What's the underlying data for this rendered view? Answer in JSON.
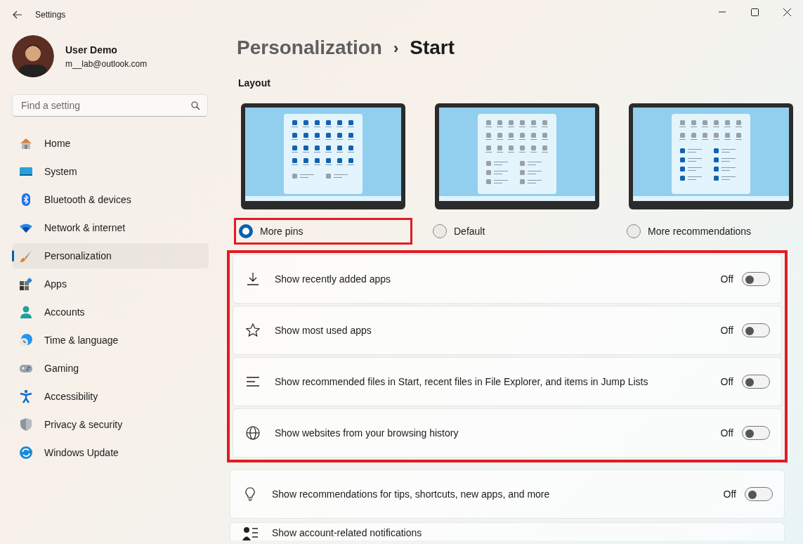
{
  "window": {
    "title": "Settings"
  },
  "user": {
    "name": "User Demo",
    "email": "m__lab@outlook.com"
  },
  "search": {
    "placeholder": "Find a setting"
  },
  "sidebar": {
    "items": [
      {
        "label": "Home",
        "selected": false
      },
      {
        "label": "System",
        "selected": false
      },
      {
        "label": "Bluetooth & devices",
        "selected": false
      },
      {
        "label": "Network & internet",
        "selected": false
      },
      {
        "label": "Personalization",
        "selected": true
      },
      {
        "label": "Apps",
        "selected": false
      },
      {
        "label": "Accounts",
        "selected": false
      },
      {
        "label": "Time & language",
        "selected": false
      },
      {
        "label": "Gaming",
        "selected": false
      },
      {
        "label": "Accessibility",
        "selected": false
      },
      {
        "label": "Privacy & security",
        "selected": false
      },
      {
        "label": "Windows Update",
        "selected": false
      }
    ]
  },
  "breadcrumb": {
    "parent": "Personalization",
    "separator": "›",
    "current": "Start"
  },
  "layout": {
    "heading": "Layout",
    "options": [
      {
        "label": "More pins",
        "selected": true,
        "highlighted": true
      },
      {
        "label": "Default",
        "selected": false,
        "highlighted": false
      },
      {
        "label": "More recommendations",
        "selected": false,
        "highlighted": false
      }
    ]
  },
  "setting_groups": [
    {
      "highlighted": true,
      "rows": [
        {
          "label": "Show recently added apps",
          "state_label": "Off",
          "on": false
        },
        {
          "label": "Show most used apps",
          "state_label": "Off",
          "on": false
        },
        {
          "label": "Show recommended files in Start, recent files in File Explorer, and items in Jump Lists",
          "state_label": "Off",
          "on": false
        },
        {
          "label": "Show websites from your browsing history",
          "state_label": "Off",
          "on": false
        }
      ]
    },
    {
      "highlighted": false,
      "rows": [
        {
          "label": "Show recommendations for tips, shortcuts, new apps, and more",
          "state_label": "Off",
          "on": false
        },
        {
          "label": "Show account-related notifications"
        }
      ]
    }
  ]
}
